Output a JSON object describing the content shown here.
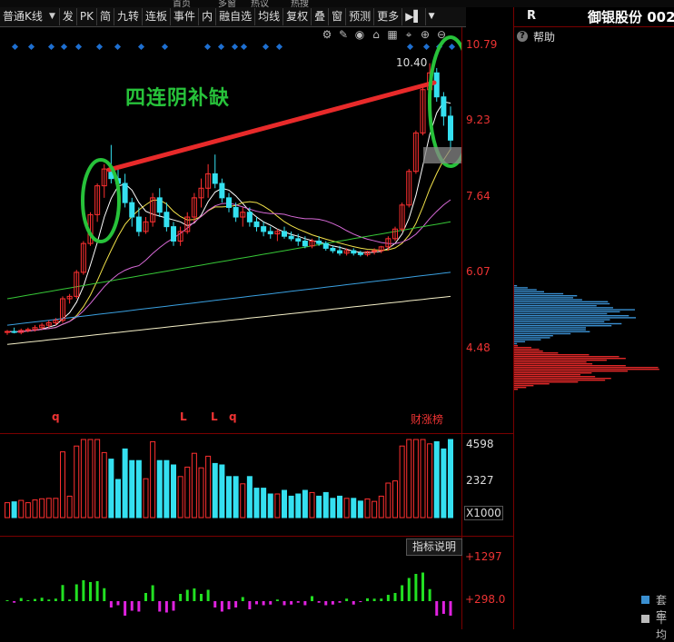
{
  "top_strip": [
    "首页",
    "多窗",
    "热议",
    "热搜"
  ],
  "toolbar": {
    "period_select": "普通K线",
    "buttons": [
      "发",
      "PK",
      "简",
      "九转",
      "连板",
      "事件",
      "内",
      "融自选",
      "均线",
      "复权",
      "叠",
      "窗",
      "预测",
      "更多"
    ]
  },
  "stock": {
    "code_prefix": "R",
    "name": "御银股份 002"
  },
  "help_label": "帮助",
  "annotation": "四连阴补缺",
  "price_axis": [
    "10.79",
    "9.23",
    "7.64",
    "6.07",
    "4.48"
  ],
  "high_label": "10.40",
  "volume_axis": [
    "4598",
    "2327",
    "X1000"
  ],
  "indicator_axis": [
    "+1297",
    "+298.0"
  ],
  "indicator_button": "指标说明",
  "badge_text": "财涨榜",
  "markers": [
    "q",
    "L",
    "L",
    "q"
  ],
  "legend": [
    {
      "label": "套牢",
      "color": "#3a8fd0"
    },
    {
      "label": "平均",
      "color": "#bbbbbb"
    }
  ],
  "colors": {
    "up": "#ff3030",
    "down": "#35e0f0",
    "axis": "#7a0000",
    "annotation": "#27c23a"
  },
  "chart_data": {
    "type": "candlestick",
    "price_ticks": [
      10.79,
      9.23,
      7.64,
      6.07,
      4.48
    ],
    "ylim": [
      4.48,
      10.79
    ],
    "candles": [
      [
        4.8,
        4.85,
        4.75,
        4.82
      ],
      [
        4.82,
        4.9,
        4.78,
        4.8
      ],
      [
        4.8,
        4.88,
        4.76,
        4.84
      ],
      [
        4.84,
        4.9,
        4.8,
        4.86
      ],
      [
        4.86,
        4.95,
        4.82,
        4.9
      ],
      [
        4.9,
        5.0,
        4.86,
        4.95
      ],
      [
        4.95,
        5.05,
        4.9,
        5.0
      ],
      [
        5.0,
        5.1,
        4.95,
        5.05
      ],
      [
        5.05,
        5.55,
        5.0,
        5.5
      ],
      [
        5.5,
        5.6,
        5.4,
        5.55
      ],
      [
        5.55,
        6.1,
        5.5,
        6.05
      ],
      [
        6.05,
        6.7,
        6.0,
        6.65
      ],
      [
        6.65,
        7.3,
        6.6,
        7.25
      ],
      [
        7.25,
        7.9,
        7.1,
        7.85
      ],
      [
        7.85,
        8.3,
        7.6,
        8.2
      ],
      [
        8.2,
        8.7,
        7.9,
        8.0
      ],
      [
        8.0,
        8.2,
        7.7,
        7.9
      ],
      [
        7.9,
        8.1,
        7.4,
        7.5
      ],
      [
        7.5,
        7.6,
        7.0,
        7.2
      ],
      [
        7.2,
        7.4,
        6.8,
        6.9
      ],
      [
        6.9,
        7.2,
        6.85,
        7.1
      ],
      [
        7.1,
        7.7,
        7.0,
        7.6
      ],
      [
        7.6,
        7.8,
        7.2,
        7.3
      ],
      [
        7.3,
        7.5,
        6.9,
        7.0
      ],
      [
        7.0,
        7.1,
        6.6,
        6.7
      ],
      [
        6.7,
        7.0,
        6.6,
        6.9
      ],
      [
        6.9,
        7.3,
        6.85,
        7.2
      ],
      [
        7.2,
        7.7,
        7.1,
        7.6
      ],
      [
        7.6,
        8.0,
        7.4,
        7.8
      ],
      [
        7.8,
        8.3,
        7.6,
        8.1
      ],
      [
        8.1,
        8.5,
        7.8,
        7.9
      ],
      [
        7.9,
        8.0,
        7.5,
        7.6
      ],
      [
        7.6,
        7.7,
        7.3,
        7.4
      ],
      [
        7.4,
        7.5,
        7.1,
        7.2
      ],
      [
        7.2,
        7.4,
        7.0,
        7.3
      ],
      [
        7.3,
        7.4,
        7.0,
        7.1
      ],
      [
        7.1,
        7.2,
        6.9,
        7.0
      ],
      [
        7.0,
        7.1,
        6.8,
        6.9
      ],
      [
        6.9,
        7.0,
        6.75,
        6.85
      ],
      [
        6.85,
        6.95,
        6.7,
        6.9
      ],
      [
        6.9,
        7.0,
        6.75,
        6.8
      ],
      [
        6.8,
        6.9,
        6.7,
        6.75
      ],
      [
        6.75,
        6.85,
        6.6,
        6.7
      ],
      [
        6.7,
        6.8,
        6.55,
        6.6
      ],
      [
        6.6,
        6.75,
        6.55,
        6.7
      ],
      [
        6.7,
        6.8,
        6.6,
        6.65
      ],
      [
        6.65,
        6.7,
        6.5,
        6.55
      ],
      [
        6.55,
        6.6,
        6.45,
        6.5
      ],
      [
        6.5,
        6.6,
        6.4,
        6.45
      ],
      [
        6.45,
        6.55,
        6.4,
        6.5
      ],
      [
        6.5,
        6.55,
        6.4,
        6.45
      ],
      [
        6.45,
        6.5,
        6.38,
        6.42
      ],
      [
        6.42,
        6.5,
        6.38,
        6.48
      ],
      [
        6.48,
        6.55,
        6.42,
        6.5
      ],
      [
        6.5,
        6.6,
        6.45,
        6.58
      ],
      [
        6.58,
        6.8,
        6.5,
        6.75
      ],
      [
        6.75,
        7.0,
        6.7,
        6.95
      ],
      [
        6.95,
        7.5,
        6.9,
        7.45
      ],
      [
        7.45,
        8.2,
        7.4,
        8.15
      ],
      [
        8.15,
        9.0,
        8.1,
        8.95
      ],
      [
        8.95,
        9.9,
        8.9,
        9.85
      ],
      [
        9.85,
        10.4,
        9.5,
        10.2
      ],
      [
        10.2,
        10.3,
        9.6,
        9.7
      ],
      [
        9.7,
        9.8,
        9.1,
        9.3
      ],
      [
        9.3,
        9.5,
        8.6,
        8.8
      ]
    ],
    "volume_ticks": [
      4598,
      2327
    ],
    "volume_unit": "X1000",
    "indicator_ticks": [
      1297,
      298.0
    ]
  }
}
